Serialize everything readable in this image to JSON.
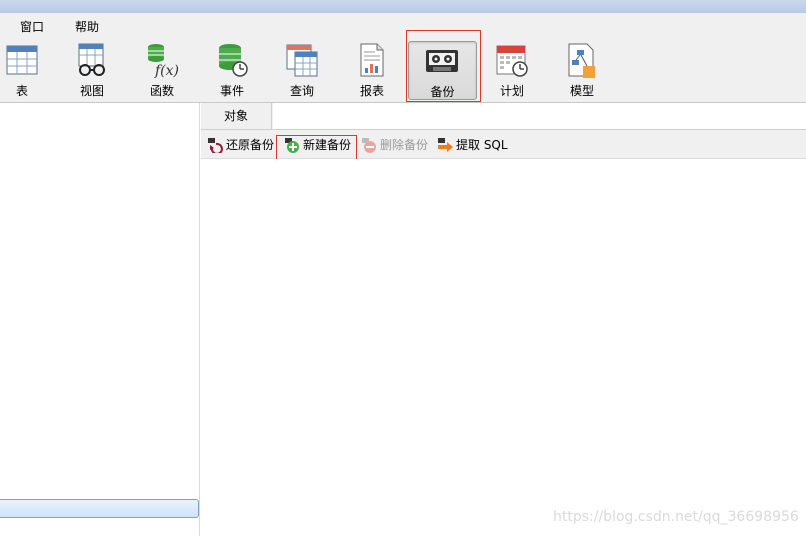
{
  "menu": [
    "窗口",
    "帮助"
  ],
  "toolbar": [
    {
      "label": "表",
      "icon": "table-icon"
    },
    {
      "label": "视图",
      "icon": "view-icon"
    },
    {
      "label": "函数",
      "icon": "function-icon"
    },
    {
      "label": "事件",
      "icon": "event-icon"
    },
    {
      "label": "查询",
      "icon": "query-icon"
    },
    {
      "label": "报表",
      "icon": "report-icon"
    },
    {
      "label": "备份",
      "icon": "backup-icon",
      "active": true
    },
    {
      "label": "计划",
      "icon": "schedule-icon"
    },
    {
      "label": "模型",
      "icon": "model-icon"
    }
  ],
  "tabs": {
    "objects": "对象"
  },
  "actions": {
    "restore": "还原备份",
    "new": "新建备份",
    "delete": "删除备份",
    "extract": "提取 SQL"
  },
  "watermark": "https://blog.csdn.net/qq_36698956",
  "colors": {
    "highlight_box": "#e0352b",
    "accent_blue": "#4f81bd"
  }
}
